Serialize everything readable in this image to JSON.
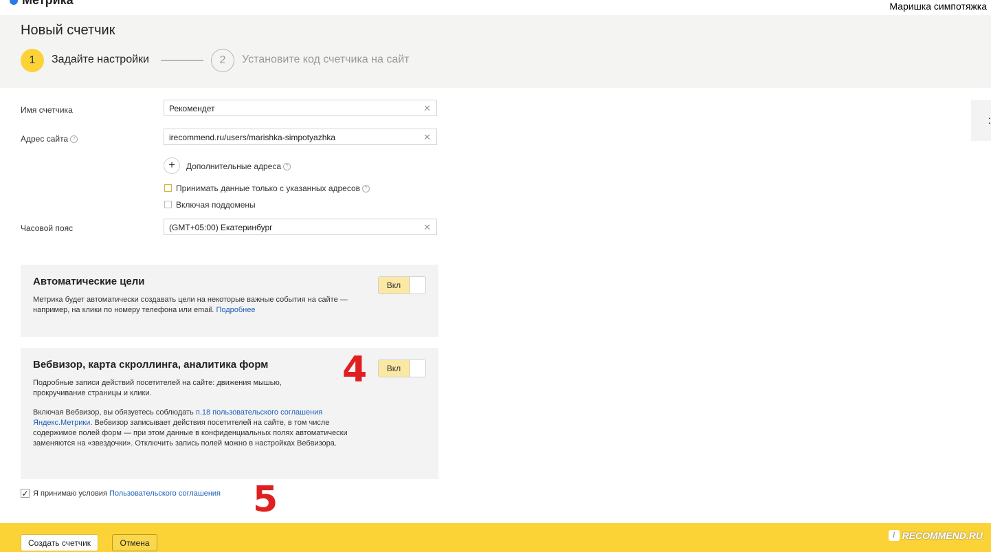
{
  "app": {
    "logo_text": "Метрика",
    "user_name": "Маришка симпотяжка"
  },
  "page": {
    "title": "Новый счетчик"
  },
  "steps": [
    {
      "number": "1",
      "label": "Задайте настройки"
    },
    {
      "number": "2",
      "label": "Установите код счетчика на сайт"
    }
  ],
  "form": {
    "counter_name": {
      "label": "Имя счетчика",
      "value": "Рекомендет"
    },
    "site_address": {
      "label": "Адрес сайта",
      "value": "irecommend.ru/users/marishka-simpotyazhka"
    },
    "add_addresses": {
      "label": "Дополнительные адреса"
    },
    "only_listed": {
      "label": "Принимать данные только с указанных адресов",
      "checked": false
    },
    "subdomains": {
      "label": "Включая поддомены",
      "checked": false
    },
    "timezone": {
      "label": "Часовой пояс",
      "value": "(GMT+05:00) Екатеринбург"
    }
  },
  "auto_goals": {
    "title": "Автоматические цели",
    "text": "Метрика будет автоматически создавать цели на некоторые важные события на сайте — например, на клики по номеру телефона или email.",
    "link": "Подробнее",
    "toggle_label": "Вкл"
  },
  "webvisor": {
    "title": "Вебвизор, карта скроллинга, аналитика форм",
    "text1": "Подробные записи действий посетителей на сайте: движения мышью, прокручивание страницы и клики.",
    "text2_prefix": "Включая Вебвизор, вы обязуетесь соблюдать",
    "text2_link": "п.18 пользовательского соглашения Яндекс.Метрики",
    "text2_suffix": ". Вебвизор записывает действия посетителей на сайте, в том числе содержимое полей форм — при этом данные в конфиденциальных полях автоматически заменяются на «звездочки». Отключить запись полей можно в настройках Вебвизора.",
    "toggle_label": "Вкл"
  },
  "annotations": {
    "mark_4": "4",
    "mark_5": "5"
  },
  "agreement": {
    "prefix": "Я принимаю условия",
    "link": "Пользовательского соглашения",
    "checked": true
  },
  "footer": {
    "create_label": "Создать счетчик",
    "cancel_label": "Отмена"
  },
  "watermark": {
    "text": "RECOMMEND.RU"
  },
  "colors": {
    "accent": "#fcd336",
    "link": "#1f5fb8",
    "annotation": "#e02020"
  }
}
